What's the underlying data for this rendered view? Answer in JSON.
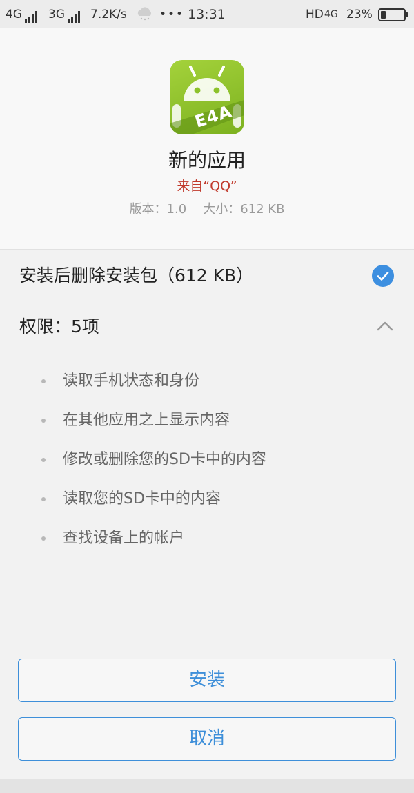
{
  "status_bar": {
    "network1": "4G",
    "network2": "3G",
    "speed": "7.2K/s",
    "more": "•••",
    "time": "13:31",
    "hd": "HD",
    "network3": "4G",
    "battery": "23%",
    "battery_level": 0.23
  },
  "app": {
    "icon_label": "E4A",
    "name": "新的应用",
    "source": "来自“QQ”",
    "version": "版本：1.0",
    "size": "大小：612 KB"
  },
  "options": {
    "delete_package_label": "安装后删除安装包（612 KB）",
    "delete_package_checked": true,
    "permissions_label": "权限：5项"
  },
  "permissions": [
    "读取手机状态和身份",
    "在其他应用之上显示内容",
    "修改或删除您的SD卡中的内容",
    "读取您的SD卡中的内容",
    "查找设备上的帐户"
  ],
  "buttons": {
    "install": "安装",
    "cancel": "取消"
  },
  "colors": {
    "accent": "#3e8fd9",
    "source_text": "#c0392b",
    "check": "#3d8fe0"
  }
}
